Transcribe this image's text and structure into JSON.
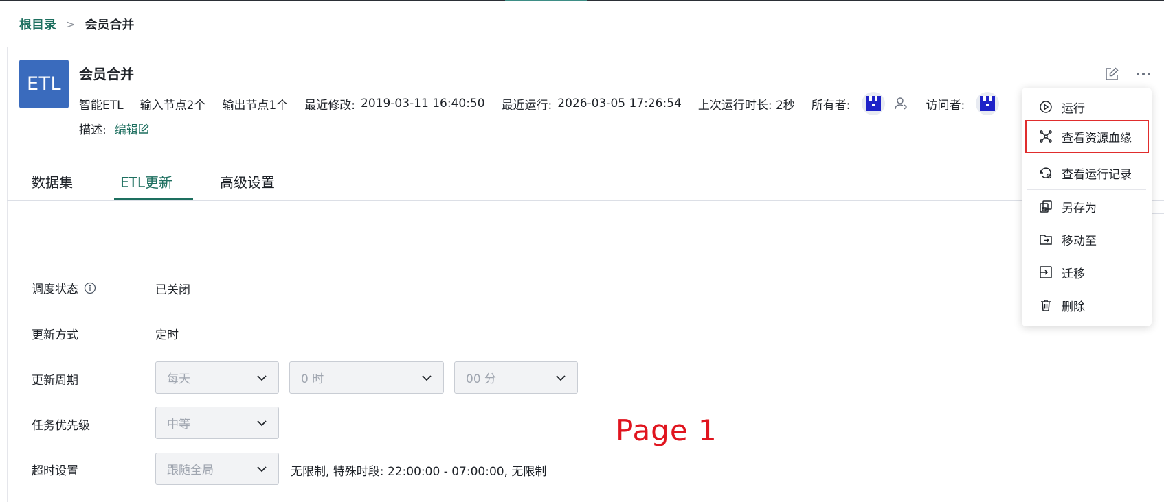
{
  "breadcrumb": {
    "root": "根目录",
    "separator": ">",
    "current": "会员合并"
  },
  "header": {
    "logo_text": "ETL",
    "title": "会员合并",
    "meta": {
      "type": "智能ETL",
      "input_nodes": "输入节点2个",
      "output_nodes": "输出节点1个",
      "modified_label": "最近修改:",
      "modified_value": "2019-03-11 16:40:50",
      "last_run_label": "最近运行:",
      "last_run_value": "2026-03-05 17:26:54",
      "duration": "上次运行时长: 2秒",
      "owner_label": "所有者:",
      "visitor_label": "访问者:"
    },
    "desc_label": "描述:",
    "desc_edit": "编辑"
  },
  "tabs": [
    {
      "label": "数据集",
      "active": false
    },
    {
      "label": "ETL更新",
      "active": true
    },
    {
      "label": "高级设置",
      "active": false
    }
  ],
  "form": {
    "schedule_status_label": "调度状态",
    "schedule_status_value": "已关闭",
    "update_mode_label": "更新方式",
    "update_mode_value": "定时",
    "update_cycle_label": "更新周期",
    "cycle_day": "每天",
    "cycle_hour": "0 时",
    "cycle_minute": "00 分",
    "priority_label": "任务优先级",
    "priority_value": "中等",
    "timeout_label": "超时设置",
    "timeout_value": "跟随全局",
    "timeout_text": "无限制, 特殊时段: 22:00:00 - 07:00:00, 无限制"
  },
  "watermark": "Page 1",
  "menu": {
    "items": [
      {
        "label": "运行",
        "icon": "play-circle-icon"
      },
      {
        "label": "查看资源血缘",
        "icon": "lineage-graph-icon",
        "highlighted": true
      },
      {
        "label": "查看运行记录",
        "icon": "run-history-icon"
      },
      {
        "label": "另存为",
        "icon": "save-as-icon"
      },
      {
        "label": "移动至",
        "icon": "move-folder-icon"
      },
      {
        "label": "迁移",
        "icon": "migrate-icon"
      },
      {
        "label": "删除",
        "icon": "trash-icon"
      }
    ]
  },
  "colors": {
    "accent": "#1d6f5f",
    "logo_bg": "#3a6bbd",
    "highlight_border": "#e02d2d",
    "watermark": "#e0141e"
  }
}
